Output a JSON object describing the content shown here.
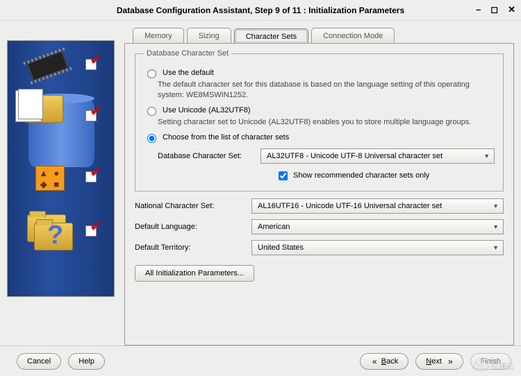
{
  "window": {
    "title": "Database Configuration Assistant, Step 9 of 11 : Initialization Parameters"
  },
  "tabs": {
    "memory": "Memory",
    "sizing": "Sizing",
    "charsets": "Character Sets",
    "connmode": "Connection Mode"
  },
  "fieldset": {
    "legend": "Database Character Set",
    "opt_default": {
      "label": "Use the default",
      "desc": "The default character set for this database is based on the language setting of this operating system: WE8MSWIN1252."
    },
    "opt_unicode": {
      "label": "Use Unicode (AL32UTF8)",
      "desc": "Setting character set to Unicode (AL32UTF8) enables you to store multiple language groups."
    },
    "opt_choose": {
      "label": "Choose from the list of character sets"
    },
    "db_charset": {
      "label": "Database Character Set:",
      "value": "AL32UTF8 - Unicode UTF-8 Universal character set"
    },
    "recommended_chk": "Show recommended character sets only"
  },
  "rows": {
    "national": {
      "label": "National Character Set:",
      "value": "AL16UTF16 - Unicode UTF-16 Universal character set"
    },
    "language": {
      "label": "Default Language:",
      "value": "American"
    },
    "territory": {
      "label": "Default Territory:",
      "value": "United States"
    }
  },
  "buttons": {
    "all_params": "All Initialization Parameters...",
    "cancel": "Cancel",
    "help": "Help",
    "back_letter": "B",
    "back_rest": "ack",
    "next_letter": "N",
    "next_rest": "ext",
    "finish": "Finish"
  },
  "watermark": "亿速云"
}
